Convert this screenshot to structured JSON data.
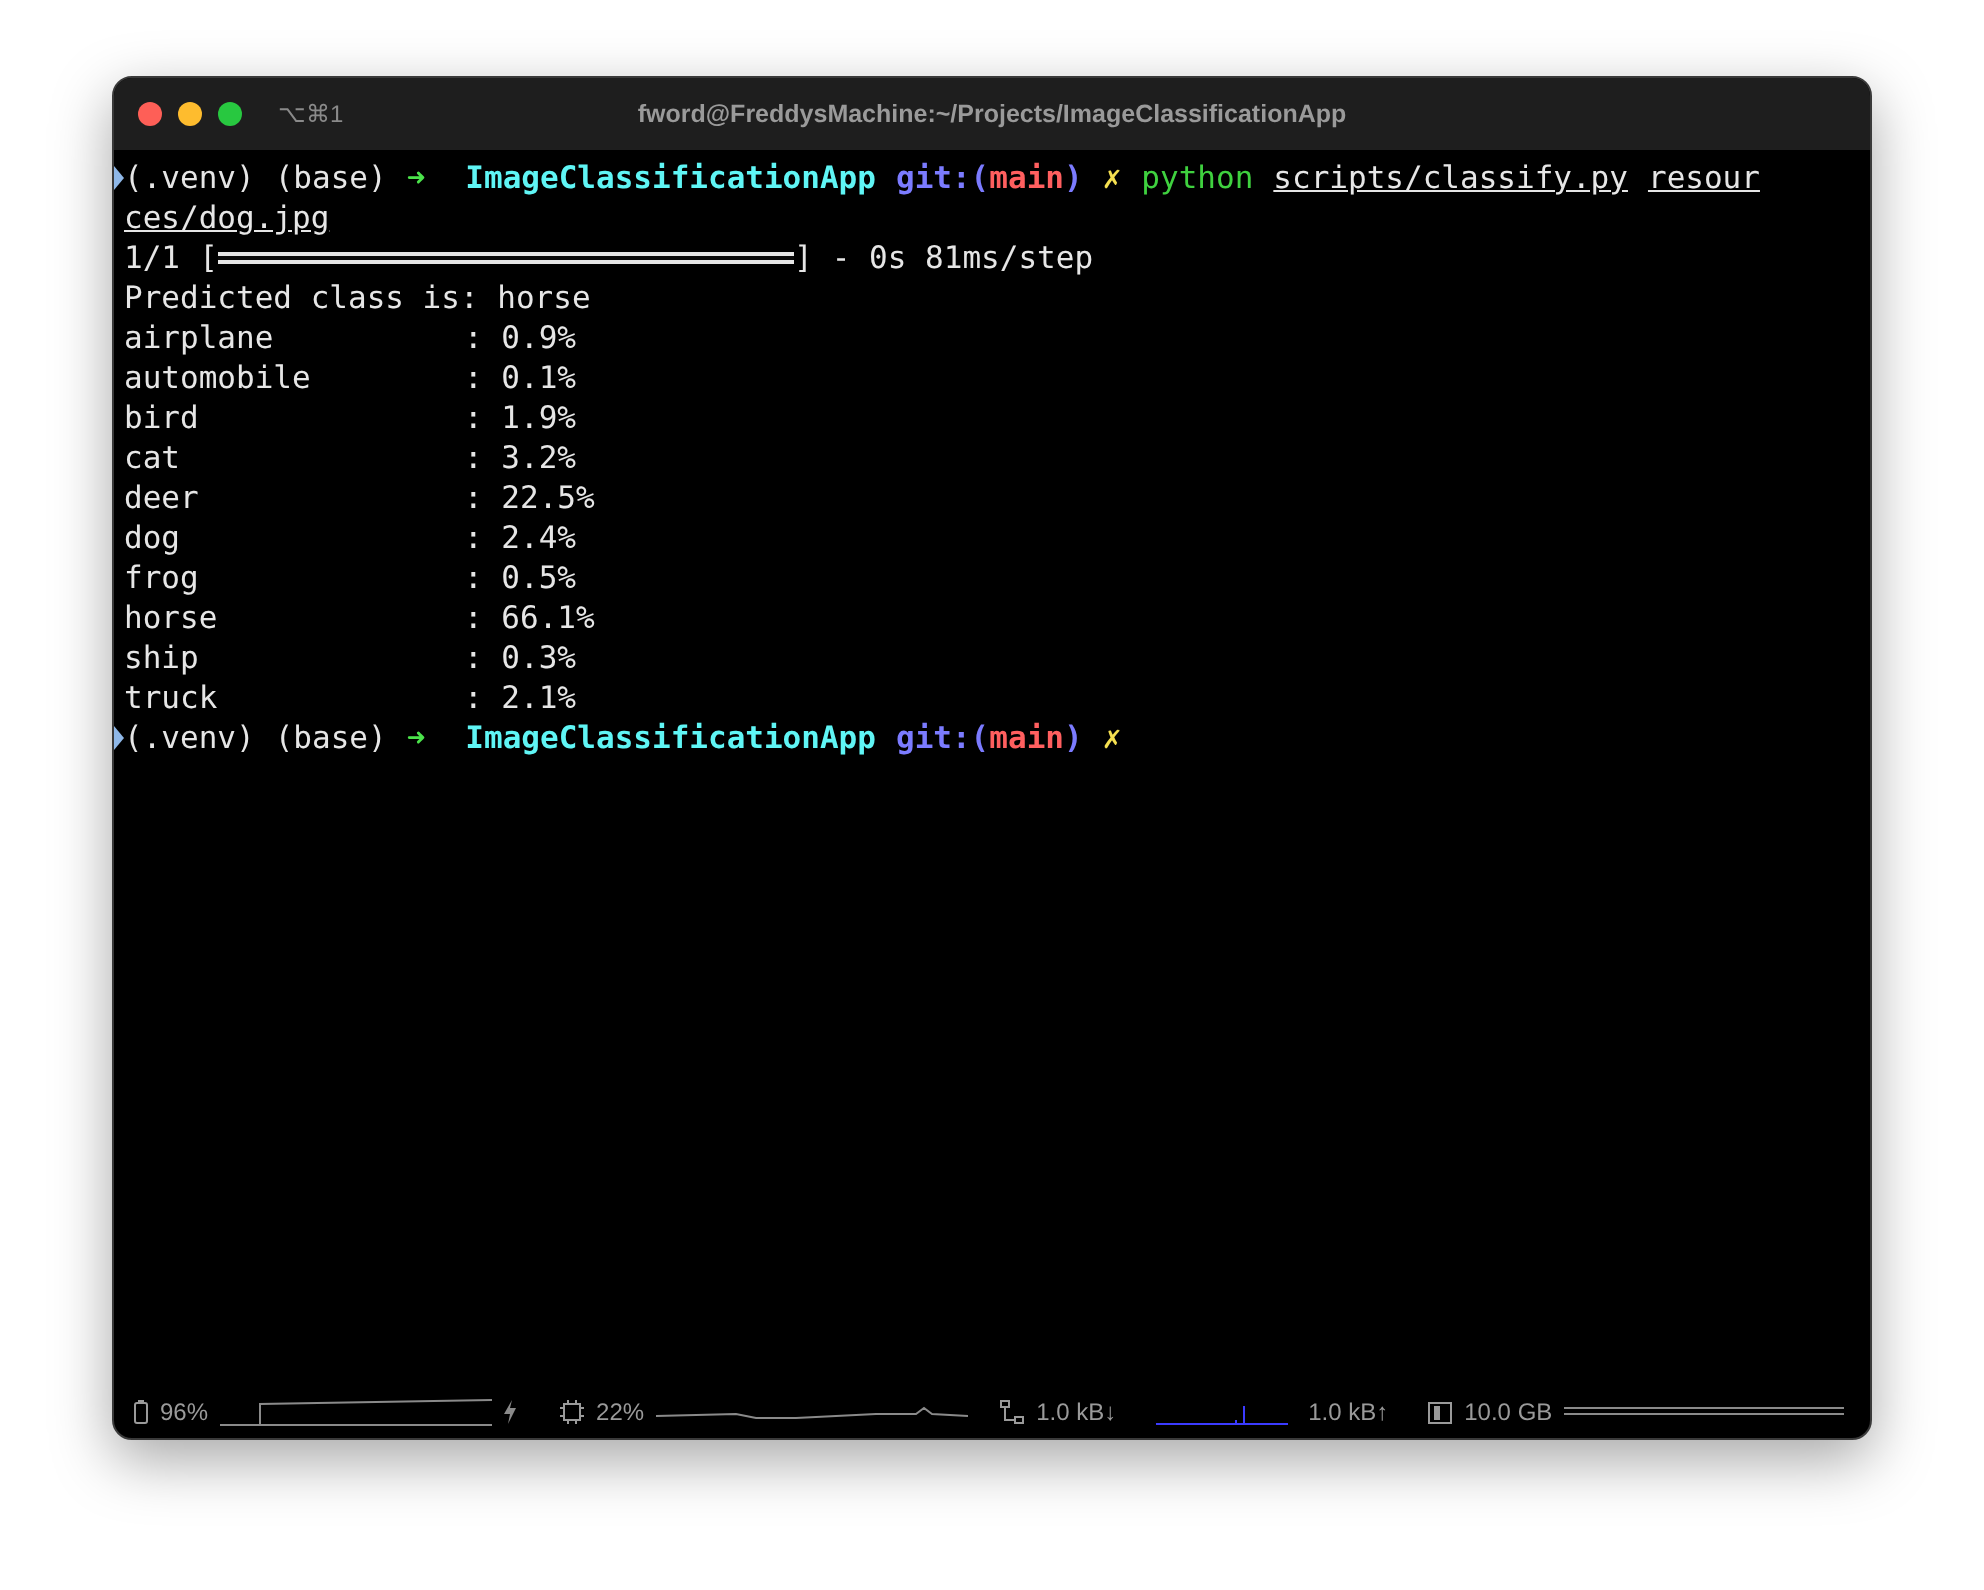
{
  "window": {
    "title": "fword@FreddysMachine:~/Projects/ImageClassificationApp",
    "shortcut": "⌥⌘1"
  },
  "terminal": {
    "lines": [
      {
        "kind": "prompt",
        "venv": "(.venv)",
        "env": "(base)",
        "arrow": "➜",
        "dir": "ImageClassificationApp",
        "git_open": "git:(",
        "branch": "main",
        "git_close": ")",
        "dirty": "✗",
        "command": "python",
        "args": [
          "scripts/classify.py",
          "resour"
        ]
      },
      {
        "kind": "continuation",
        "text": "ces/dog.jpg"
      },
      {
        "kind": "progress",
        "count": "1/1",
        "open": "[",
        "level": 1,
        "close": "]",
        "timing": "- 0s 81ms/step"
      },
      {
        "kind": "text",
        "text": "Predicted class is: horse"
      },
      {
        "kind": "result",
        "label": "airplane",
        "value": ": 0.9%"
      },
      {
        "kind": "result",
        "label": "automobile",
        "value": ": 0.1%"
      },
      {
        "kind": "result",
        "label": "bird",
        "value": ": 1.9%"
      },
      {
        "kind": "result",
        "label": "cat",
        "value": ": 3.2%"
      },
      {
        "kind": "result",
        "label": "deer",
        "value": ": 22.5%"
      },
      {
        "kind": "result",
        "label": "dog",
        "value": ": 2.4%"
      },
      {
        "kind": "result",
        "label": "frog",
        "value": ": 0.5%"
      },
      {
        "kind": "result",
        "label": "horse",
        "value": ": 66.1%"
      },
      {
        "kind": "result",
        "label": "ship",
        "value": ": 0.3%"
      },
      {
        "kind": "result",
        "label": "truck",
        "value": ": 2.1%"
      },
      {
        "kind": "prompt",
        "venv": "(.venv)",
        "env": "(base)",
        "arrow": "➜",
        "dir": "ImageClassificationApp",
        "git_open": "git:(",
        "branch": "main",
        "git_close": ")",
        "dirty": "✗"
      }
    ]
  },
  "status_bar": {
    "battery": "96%",
    "cpu": "22%",
    "download": "1.0 kB↓",
    "upload": "1.0 kB↑",
    "memory": "10.0 GB"
  }
}
